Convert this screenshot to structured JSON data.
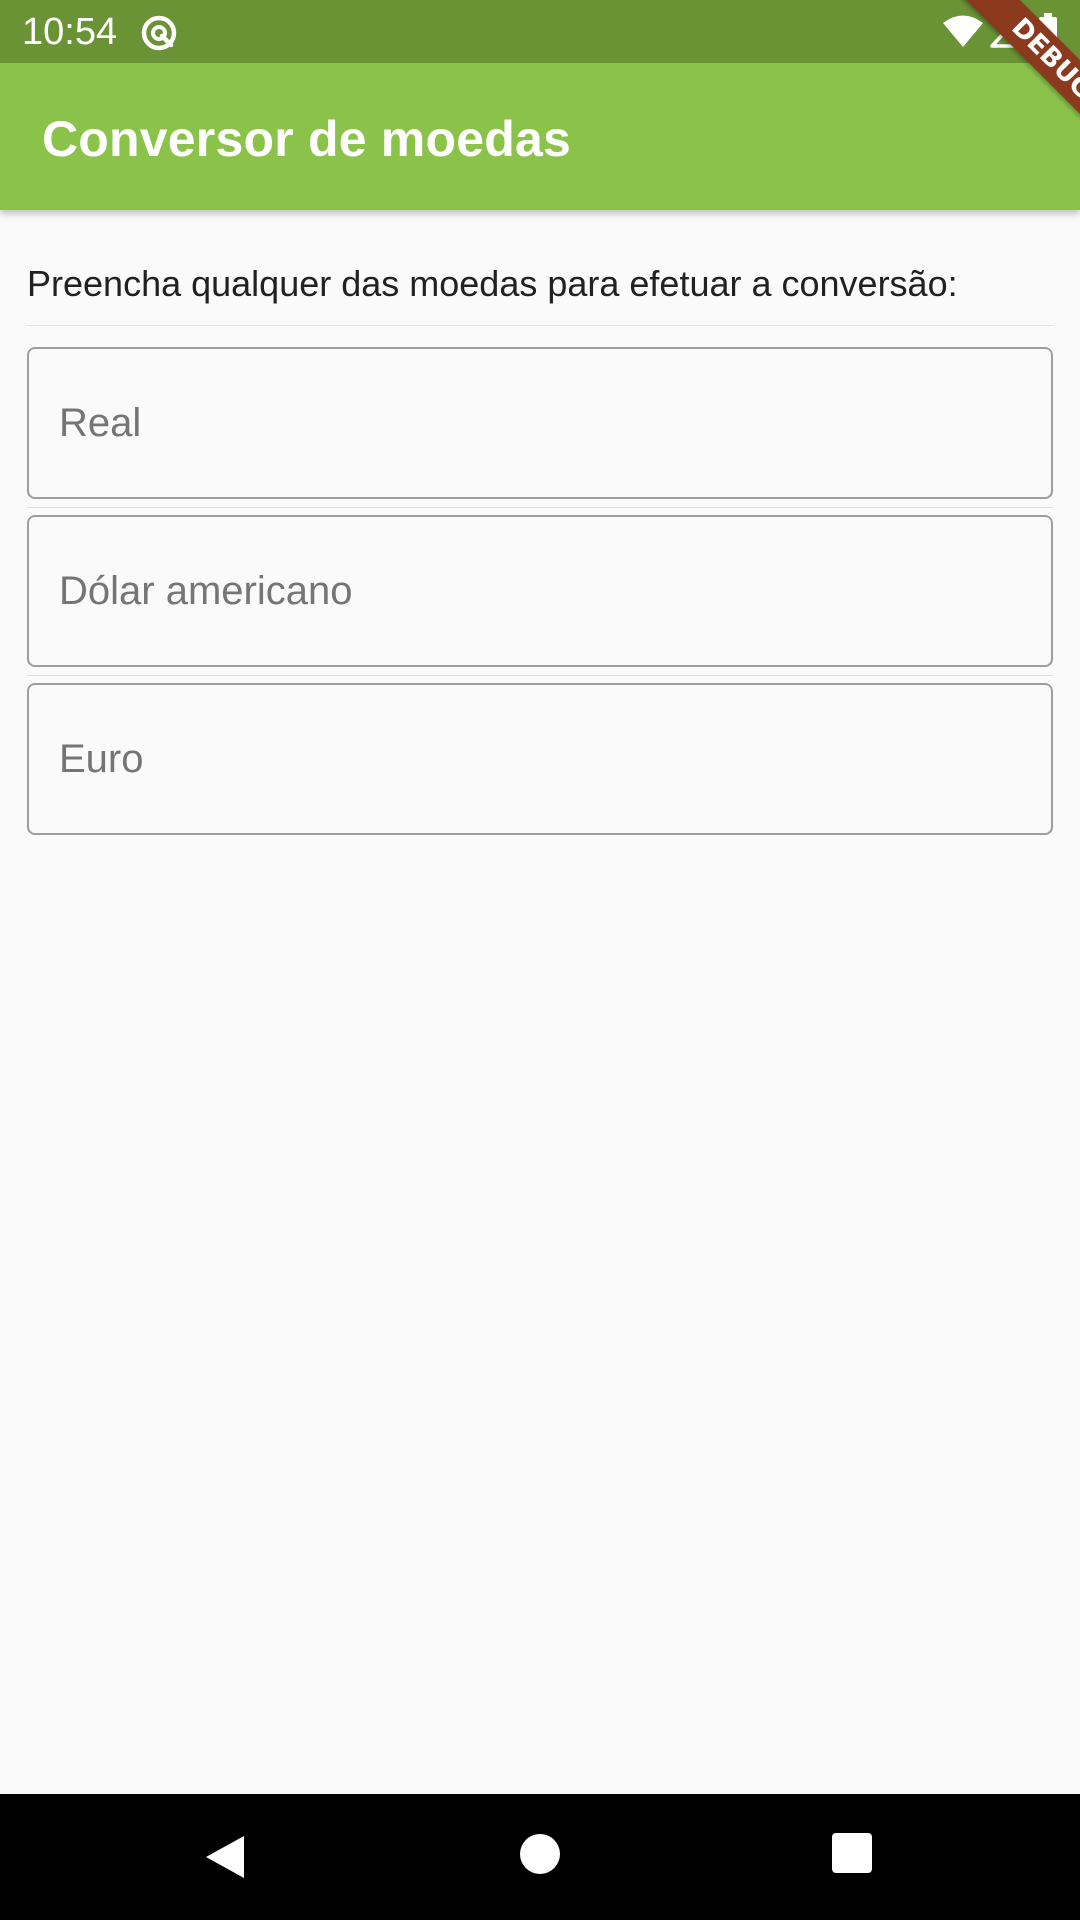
{
  "status_bar": {
    "time": "10:54",
    "icons": [
      "app-notification-icon",
      "wifi-icon",
      "signal-icon",
      "battery-icon"
    ],
    "background_color": "#6a9336"
  },
  "app_bar": {
    "title": "Conversor de moedas",
    "background_color": "#8bc34a"
  },
  "debug_banner": {
    "label": "DEBUG",
    "color": "#8b3a1e"
  },
  "content": {
    "instructions": "Preencha qualquer das moedas para efetuar a conversão:",
    "fields": [
      {
        "placeholder": "Real",
        "value": ""
      },
      {
        "placeholder": "Dólar americano",
        "value": ""
      },
      {
        "placeholder": "Euro",
        "value": ""
      }
    ]
  },
  "nav_bar": {
    "buttons": [
      "back-icon",
      "home-icon",
      "recents-icon"
    ]
  }
}
